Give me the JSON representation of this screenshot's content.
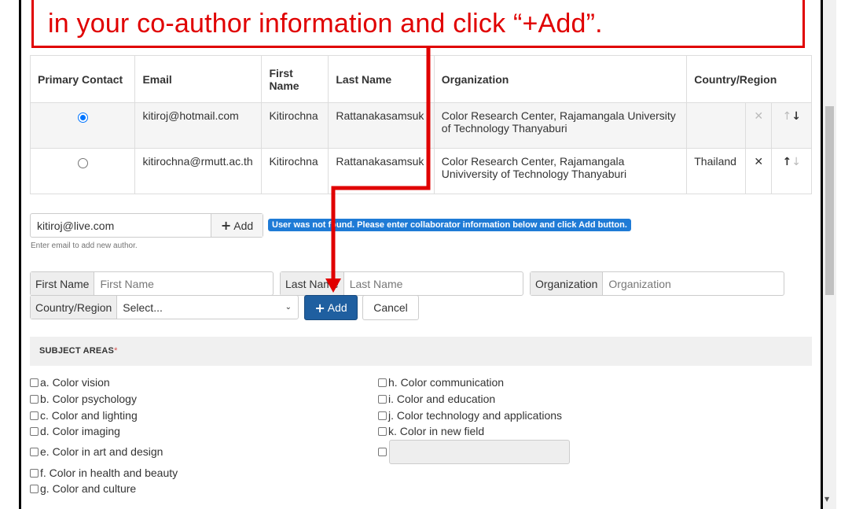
{
  "callout": {
    "text": "in your co-author information and click “+Add”."
  },
  "author_table": {
    "headers": [
      "Primary Contact",
      "Email",
      "First Name",
      "Last Name",
      "Organization",
      "Country/Region"
    ],
    "rows": [
      {
        "primary": true,
        "email": "kitiroj@hotmail.com",
        "first_name": "Kitirochna",
        "last_name": "Rattanakasamsuk",
        "organization": "Color Research Center, Rajamangala University of Technology Thanyaburi",
        "country": "",
        "delete_icon": "times-icon",
        "delete_enabled": false,
        "move_up_enabled": false,
        "move_down_enabled": true
      },
      {
        "primary": false,
        "email": "kitirochna@rmutt.ac.th",
        "first_name": "Kitirochna",
        "last_name": "Rattanakasamsuk",
        "organization": "Color Research Center, Rajamangala Univiversity of Technology Thanyaburi",
        "country": "Thailand",
        "delete_icon": "times-icon",
        "delete_enabled": true,
        "move_up_enabled": true,
        "move_down_enabled": false
      }
    ]
  },
  "add_author": {
    "email_value": "kitiroj@live.com",
    "add_label": "Add",
    "help_text": "Enter email to add new author.",
    "notice": "User was not found. Please enter collaborator information below and click Add button."
  },
  "collaborator_form": {
    "first_name_label": "First Name",
    "first_name_placeholder": "First Name",
    "last_name_label": "Last Name",
    "last_name_placeholder": "Last Name",
    "organization_label": "Organization",
    "organization_placeholder": "Organization",
    "country_label": "Country/Region",
    "country_selected": "Select...",
    "add_label": "Add",
    "cancel_label": "Cancel"
  },
  "subject_areas": {
    "title": "SUBJECT AREAS",
    "required_mark": "*",
    "left": [
      "a. Color vision",
      "b. Color psychology",
      "c. Color and lighting",
      "d. Color imaging",
      "e. Color in art and design",
      "f. Color in health and beauty",
      "g. Color and culture"
    ],
    "right": [
      "h. Color communication",
      "i. Color and education",
      "j. Color technology and applications",
      "k. Color in new field"
    ]
  },
  "colors": {
    "callout_red": "#e00000",
    "primary_button": "#1f5fa0",
    "notice_blue": "#1f7bd6",
    "radio_blue": "#0075ff"
  }
}
